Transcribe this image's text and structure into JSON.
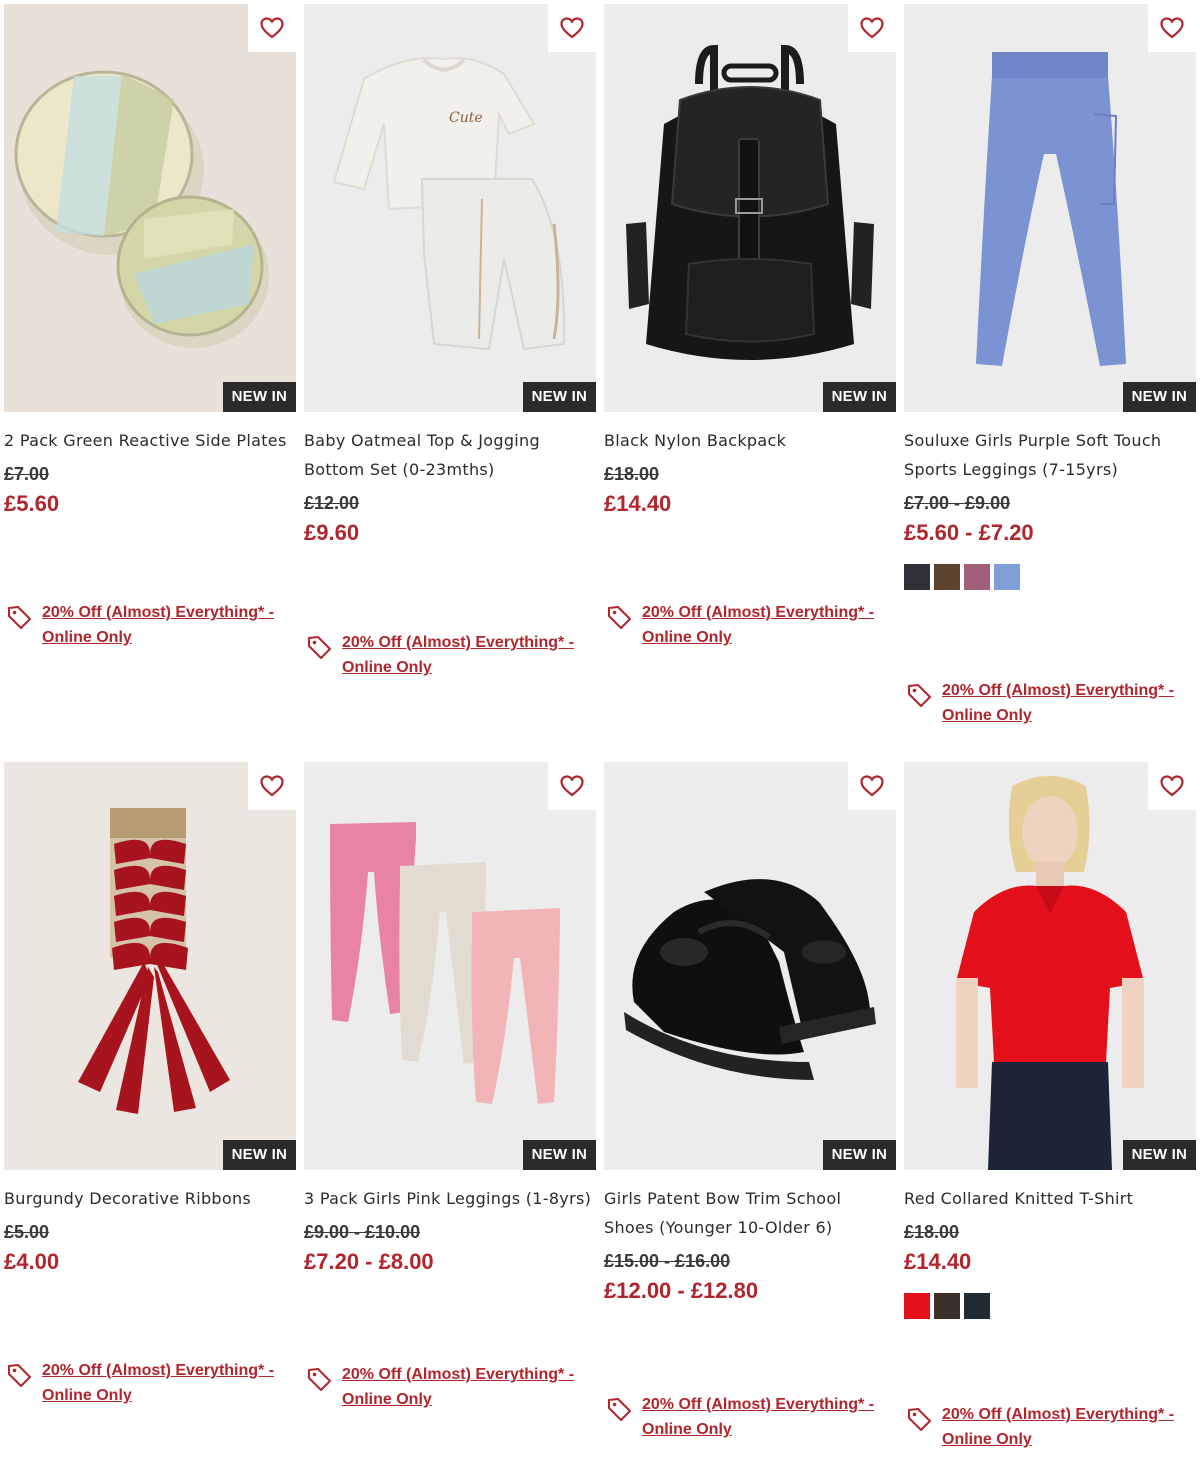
{
  "badge_label": "NEW IN",
  "promo_label_line1": "20% Off (Almost) Everything* -",
  "promo_label_line2": "Online Only",
  "colors": {
    "price_red": "#b1252d",
    "badge_bg": "#2b2b2b"
  },
  "icons": {
    "wishlist": "heart-outline-icon",
    "promo": "price-tag-icon"
  },
  "products": [
    {
      "title": "2 Pack Green Reactive Side Plates",
      "was": "£7.00",
      "now": "£5.60",
      "swatches": []
    },
    {
      "title": "Baby Oatmeal Top & Jogging Bottom Set (0-23mths)",
      "was": "£12.00",
      "now": "£9.60",
      "swatches": []
    },
    {
      "title": "Black Nylon Backpack",
      "was": "£18.00",
      "now": "£14.40",
      "swatches": []
    },
    {
      "title": "Souluxe Girls Purple Soft Touch Sports Leggings (7-15yrs)",
      "was": "£7.00 - £9.00",
      "now": "£5.60 - £7.20",
      "swatches": [
        "#2f3136",
        "#5c4330",
        "#a0607a",
        "#7f9fd6"
      ]
    },
    {
      "title": "Burgundy Decorative Ribbons",
      "was": "£5.00",
      "now": "£4.00",
      "swatches": []
    },
    {
      "title": "3 Pack Girls Pink Leggings (1-8yrs)",
      "was": "£9.00 - £10.00",
      "now": "£7.20 - £8.00",
      "swatches": []
    },
    {
      "title": "Girls Patent Bow Trim School Shoes (Younger 10-Older 6)",
      "was": "£15.00 - £16.00",
      "now": "£12.00 - £12.80",
      "swatches": []
    },
    {
      "title": "Red Collared Knitted T-Shirt",
      "was": "£18.00",
      "now": "£14.40",
      "swatches": [
        "#e3101c",
        "#3b3028",
        "#1f2a33"
      ]
    }
  ]
}
